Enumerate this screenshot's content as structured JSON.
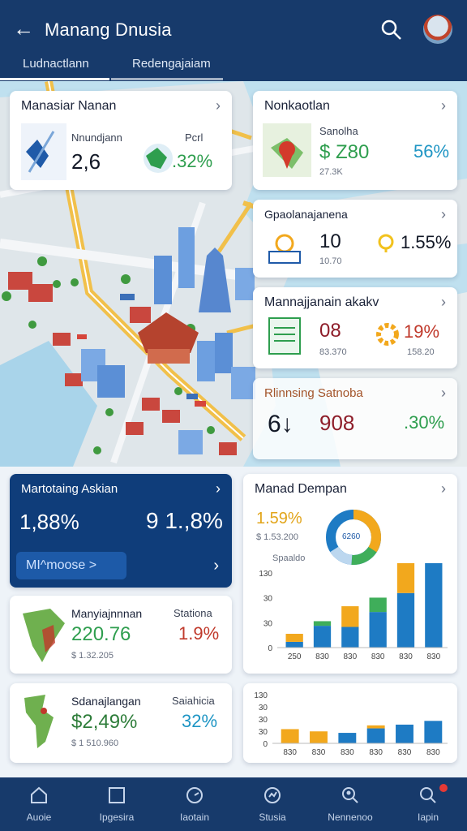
{
  "header": {
    "title": "Manang Dnusia"
  },
  "tabs": [
    {
      "label": "Ludnactlann"
    },
    {
      "label": "Redengajaiam"
    }
  ],
  "cards": {
    "c1": {
      "title": "Manasiar Nanan",
      "sub": "Nnundjann",
      "value": "2,6",
      "percent_label": "Pcrl",
      "percent": ".32%"
    },
    "c2": {
      "title": "Nonkaotlan",
      "label": "Sanolha",
      "value": "$ Z80",
      "sub": "27.3K",
      "percent": "56%"
    },
    "c3": {
      "title": "Gpaolanajanena",
      "value": "10",
      "sub": "10.70",
      "percent": "1.55%"
    },
    "c4": {
      "title": "Mannajjanain akakv",
      "value": "08",
      "sub": "83.370",
      "percent": "19%",
      "sub2": "158.20"
    },
    "c5": {
      "title": "Rlinnsing Satnoba",
      "value1": "6↓",
      "value2": "908",
      "percent": ".30%"
    },
    "blue": {
      "title": "Martotaing Askian",
      "value1": "1,88%",
      "value2": "9 1.,8%",
      "button": "MI^moose >"
    },
    "c6": {
      "title": "Manyiajnnnan",
      "value": "220.76",
      "sub": "$ 1.32.205",
      "side_label": "Stationa",
      "side_value": "1.9%"
    },
    "c7": {
      "title": "Sdanajlangan",
      "value": "$2,49%",
      "sub": "$ 1 510.960",
      "side_label": "Saiahicia",
      "side_value": "32%"
    },
    "chart1": {
      "title": "Manad Dempan",
      "donut_value": "1.59%",
      "donut_sub": "$ 1.53.200",
      "donut_center": "6260",
      "caption": "Spaaldo"
    }
  },
  "chart_data": [
    {
      "type": "bar",
      "title": "Manad Dempan",
      "categories": [
        "250",
        "830",
        "830",
        "830",
        "830",
        "830"
      ],
      "yticks": [
        "130",
        "30",
        "30",
        "0"
      ],
      "ylim": [
        0,
        130
      ],
      "series": [
        {
          "color": "#1e7bc4",
          "values": [
            10,
            38,
            36,
            62,
            95,
            150
          ]
        },
        {
          "color": "#3fae5a",
          "values": [
            0,
            8,
            0,
            25,
            0,
            0
          ]
        },
        {
          "color": "#f2a81d",
          "values": [
            14,
            0,
            36,
            0,
            73,
            30
          ]
        }
      ]
    },
    {
      "type": "bar",
      "categories": [
        "830",
        "830",
        "830",
        "830",
        "830",
        "830"
      ],
      "yticks": [
        "130",
        "30",
        "30",
        "30",
        "0"
      ],
      "ylim": [
        0,
        130
      ],
      "series": [
        {
          "color": "#1e7bc4",
          "values": [
            0,
            0,
            28,
            40,
            50,
            60
          ]
        },
        {
          "color": "#3fae5a",
          "values": [
            0,
            0,
            0,
            0,
            0,
            0
          ]
        },
        {
          "color": "#f2a81d",
          "values": [
            38,
            32,
            0,
            8,
            0,
            0
          ]
        }
      ]
    }
  ],
  "nav": [
    {
      "label": "Auoie",
      "icon": "home-icon"
    },
    {
      "label": "Ipgesira",
      "icon": "square-icon"
    },
    {
      "label": "Iaotain",
      "icon": "gauge-icon"
    },
    {
      "label": "Stusia",
      "icon": "chart-icon"
    },
    {
      "label": "Nennenoo",
      "icon": "search-person-icon"
    },
    {
      "label": "Iapin",
      "icon": "search-icon"
    }
  ]
}
